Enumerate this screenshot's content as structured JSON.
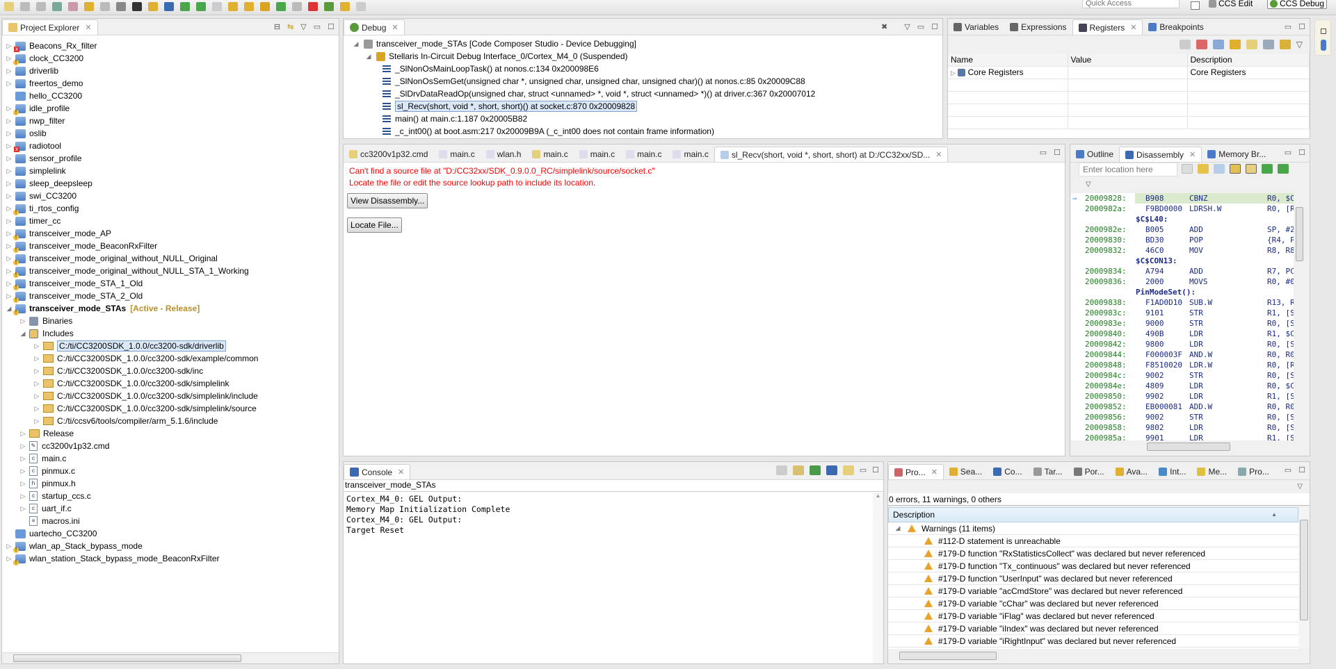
{
  "toolbar": {
    "quick_access_placeholder": "Quick Access",
    "perspectives": [
      "CCS Edit",
      "CCS Debug"
    ]
  },
  "project_explorer": {
    "title": "Project Explorer",
    "items": [
      {
        "label": "Beacons_Rx_filter",
        "level": 0,
        "type": "project",
        "badge": "err",
        "expanded": false
      },
      {
        "label": "clock_CC3200",
        "level": 0,
        "type": "project",
        "badge": "warn",
        "expanded": false
      },
      {
        "label": "driverlib",
        "level": 0,
        "type": "project",
        "badge": "",
        "expanded": false
      },
      {
        "label": "freertos_demo",
        "level": 0,
        "type": "project",
        "badge": "",
        "expanded": false
      },
      {
        "label": "hello_CC3200",
        "level": 0,
        "type": "closed",
        "badge": "",
        "expanded": null
      },
      {
        "label": "idle_profile",
        "level": 0,
        "type": "project",
        "badge": "warn",
        "expanded": false
      },
      {
        "label": "nwp_filter",
        "level": 0,
        "type": "project",
        "badge": "",
        "expanded": false
      },
      {
        "label": "oslib",
        "level": 0,
        "type": "project",
        "badge": "",
        "expanded": false
      },
      {
        "label": "radiotool",
        "level": 0,
        "type": "project",
        "badge": "err",
        "expanded": false
      },
      {
        "label": "sensor_profile",
        "level": 0,
        "type": "project",
        "badge": "",
        "expanded": false
      },
      {
        "label": "simplelink",
        "level": 0,
        "type": "project",
        "badge": "",
        "expanded": false
      },
      {
        "label": "sleep_deepsleep",
        "level": 0,
        "type": "project",
        "badge": "",
        "expanded": false
      },
      {
        "label": "swi_CC3200",
        "level": 0,
        "type": "project",
        "badge": "",
        "expanded": false
      },
      {
        "label": "ti_rtos_config",
        "level": 0,
        "type": "project",
        "badge": "warn",
        "expanded": false
      },
      {
        "label": "timer_cc",
        "level": 0,
        "type": "project",
        "badge": "",
        "expanded": false
      },
      {
        "label": "transceiver_mode_AP",
        "level": 0,
        "type": "project",
        "badge": "warn",
        "expanded": false
      },
      {
        "label": "transceiver_mode_BeaconRxFilter",
        "level": 0,
        "type": "project",
        "badge": "warn",
        "expanded": false
      },
      {
        "label": "transceiver_mode_original_without_NULL_Original",
        "level": 0,
        "type": "project",
        "badge": "warn",
        "expanded": false
      },
      {
        "label": "transceiver_mode_original_without_NULL_STA_1_Working",
        "level": 0,
        "type": "project",
        "badge": "warn",
        "expanded": false
      },
      {
        "label": "transceiver_mode_STA_1_Old",
        "level": 0,
        "type": "project",
        "badge": "warn",
        "expanded": false
      },
      {
        "label": "transceiver_mode_STA_2_Old",
        "level": 0,
        "type": "project",
        "badge": "warn",
        "expanded": false
      },
      {
        "label": "transceiver_mode_STAs",
        "level": 0,
        "type": "project",
        "badge": "warn",
        "expanded": true,
        "bold": true,
        "suffix": "[Active - Release]"
      },
      {
        "label": "Binaries",
        "level": 1,
        "type": "binaries",
        "badge": "",
        "expanded": false
      },
      {
        "label": "Includes",
        "level": 1,
        "type": "includes",
        "badge": "",
        "expanded": true
      },
      {
        "label": "C:/ti/CC3200SDK_1.0.0/cc3200-sdk/driverlib",
        "level": 2,
        "type": "incfolder",
        "badge": "",
        "expanded": false,
        "selected": true
      },
      {
        "label": "C:/ti/CC3200SDK_1.0.0/cc3200-sdk/example/common",
        "level": 2,
        "type": "incfolder",
        "badge": "",
        "expanded": false
      },
      {
        "label": "C:/ti/CC3200SDK_1.0.0/cc3200-sdk/inc",
        "level": 2,
        "type": "incfolder",
        "badge": "",
        "expanded": false
      },
      {
        "label": "C:/ti/CC3200SDK_1.0.0/cc3200-sdk/simplelink",
        "level": 2,
        "type": "incfolder",
        "badge": "",
        "expanded": false
      },
      {
        "label": "C:/ti/CC3200SDK_1.0.0/cc3200-sdk/simplelink/include",
        "level": 2,
        "type": "incfolder",
        "badge": "",
        "expanded": false
      },
      {
        "label": "C:/ti/CC3200SDK_1.0.0/cc3200-sdk/simplelink/source",
        "level": 2,
        "type": "incfolder",
        "badge": "",
        "expanded": false
      },
      {
        "label": "C:/ti/ccsv6/tools/compiler/arm_5.1.6/include",
        "level": 2,
        "type": "incfolder",
        "badge": "",
        "expanded": false
      },
      {
        "label": "Release",
        "level": 1,
        "type": "folder",
        "badge": "",
        "expanded": false
      },
      {
        "label": "cc3200v1p32.cmd",
        "level": 1,
        "type": "file",
        "glyph": "✎",
        "badge": "",
        "expanded": false
      },
      {
        "label": "main.c",
        "level": 1,
        "type": "file",
        "glyph": "c",
        "badge": "warn",
        "expanded": false
      },
      {
        "label": "pinmux.c",
        "level": 1,
        "type": "file",
        "glyph": "c",
        "badge": "",
        "expanded": false
      },
      {
        "label": "pinmux.h",
        "level": 1,
        "type": "file",
        "glyph": "h",
        "badge": "",
        "expanded": false
      },
      {
        "label": "startup_ccs.c",
        "level": 1,
        "type": "file",
        "glyph": "c",
        "badge": "",
        "expanded": false
      },
      {
        "label": "uart_if.c",
        "level": 1,
        "type": "file",
        "glyph": "c",
        "badge": "",
        "expanded": false
      },
      {
        "label": "macros.ini",
        "level": 1,
        "type": "file",
        "glyph": "≡",
        "badge": "",
        "expanded": null
      },
      {
        "label": "uartecho_CC3200",
        "level": 0,
        "type": "closed",
        "badge": "",
        "expanded": null
      },
      {
        "label": "wlan_ap_Stack_bypass_mode",
        "level": 0,
        "type": "project",
        "badge": "warn",
        "expanded": false
      },
      {
        "label": "wlan_station_Stack_bypass_mode_BeaconRxFilter",
        "level": 0,
        "type": "project",
        "badge": "warn",
        "expanded": false
      }
    ]
  },
  "debug": {
    "title": "Debug",
    "session": "transceiver_mode_STAs [Code Composer Studio - Device Debugging]",
    "target": "Stellaris In-Circuit Debug Interface_0/Cortex_M4_0 (Suspended)",
    "frames": [
      "_SlNonOsMainLoopTask() at nonos.c:134 0x200098E6",
      "_SlNonOsSemGet(unsigned char *, unsigned char, unsigned char, unsigned char)() at nonos.c:85 0x20009C88",
      "_SlDrvDataReadOp(unsigned char, struct <unnamed> *, void *, struct <unnamed> *)() at driver.c:367 0x20007012",
      "sl_Recv(short, void *, short, short)() at socket.c:870 0x20009828",
      "main() at main.c:1.187 0x20005B82",
      "_c_int00() at boot.asm:217 0x20009B9A  (_c_int00 does not contain frame information)"
    ],
    "selected_frame": 3
  },
  "variables": {
    "tabs": [
      "Variables",
      "Expressions",
      "Registers",
      "Breakpoints"
    ],
    "active_tab": 2,
    "columns": [
      "Name",
      "Value",
      "Description"
    ],
    "rows": [
      {
        "name": "Core Registers",
        "value": "",
        "description": "Core Registers"
      }
    ]
  },
  "editor": {
    "tabs": [
      "cc3200v1p32.cmd",
      "main.c",
      "wlan.h",
      "main.c",
      "main.c",
      "main.c",
      "main.c",
      "sl_Recv(short, void *, short, short) at D:/CC32xx/SD..."
    ],
    "active_tab": 7,
    "error_line1": "Can't find a source file at \"D:/CC32xx/SDK_0.9.0.0_RC/simplelink/source/socket.c\"",
    "error_line2": "Locate the file or edit the source lookup path to include its location.",
    "view_disassembly": "View Disassembly...",
    "locate_file": "Locate File..."
  },
  "disassembly": {
    "tabs": [
      "Outline",
      "Disassembly",
      "Memory Br..."
    ],
    "active_tab": 1,
    "location_placeholder": "Enter location here",
    "lines": [
      {
        "addr": "20009828:",
        "op": "B908",
        "mn": "CBNZ",
        "arg": "R0, $C",
        "current": true
      },
      {
        "addr": "2000982a:",
        "op": "F9BD0000",
        "mn": "LDRSH.W",
        "arg": "R0, [R"
      },
      {
        "label": "$C$L40:"
      },
      {
        "addr": "2000982e:",
        "op": "B005",
        "mn": "ADD",
        "arg": "SP, #2"
      },
      {
        "addr": "20009830:",
        "op": "BD30",
        "mn": "POP",
        "arg": "{R4, P"
      },
      {
        "addr": "20009832:",
        "op": "46C0",
        "mn": "MOV",
        "arg": "R8, R8"
      },
      {
        "label": "$C$CON13:"
      },
      {
        "addr": "20009834:",
        "op": "A794",
        "mn": "ADD",
        "arg": "R7, PC"
      },
      {
        "addr": "20009836:",
        "op": "2000",
        "mn": "MOVS",
        "arg": "R0, #0"
      },
      {
        "label": "PinModeSet():"
      },
      {
        "addr": "20009838:",
        "op": "F1AD0D10",
        "mn": "SUB.W",
        "arg": "R13, R"
      },
      {
        "addr": "2000983c:",
        "op": "9101",
        "mn": "STR",
        "arg": "R1, [S"
      },
      {
        "addr": "2000983e:",
        "op": "9000",
        "mn": "STR",
        "arg": "R0, [S"
      },
      {
        "addr": "20009840:",
        "op": "490B",
        "mn": "LDR",
        "arg": "R1, $C"
      },
      {
        "addr": "20009842:",
        "op": "9800",
        "mn": "LDR",
        "arg": "R0, [S"
      },
      {
        "addr": "20009844:",
        "op": "F000003F",
        "mn": "AND.W",
        "arg": "R0, R0"
      },
      {
        "addr": "20009848:",
        "op": "F8510020",
        "mn": "LDR.W",
        "arg": "R0, [R"
      },
      {
        "addr": "2000984c:",
        "op": "9002",
        "mn": "STR",
        "arg": "R0, [S"
      },
      {
        "addr": "2000984e:",
        "op": "4809",
        "mn": "LDR",
        "arg": "R0, $C"
      },
      {
        "addr": "20009850:",
        "op": "9902",
        "mn": "LDR",
        "arg": "R1, [S"
      },
      {
        "addr": "20009852:",
        "op": "EB000081",
        "mn": "ADD.W",
        "arg": "R0, R0"
      },
      {
        "addr": "20009856:",
        "op": "9002",
        "mn": "STR",
        "arg": "R0, [S"
      },
      {
        "addr": "20009858:",
        "op": "9802",
        "mn": "LDR",
        "arg": "R0, [S"
      },
      {
        "addr": "2000985a:",
        "op": "9901",
        "mn": "LDR",
        "arg": "R1, [S"
      }
    ]
  },
  "console": {
    "title": "Console",
    "process": "transceiver_mode_STAs",
    "lines": [
      "Cortex_M4_0: GEL Output:",
      "Memory Map Initialization Complete",
      "Cortex_M4_0: GEL Output:",
      "Target Reset"
    ]
  },
  "problems": {
    "tabs": [
      "Pro...",
      "Sea...",
      "Co...",
      "Tar...",
      "Por...",
      "Ava...",
      "Int...",
      "Me...",
      "Pro..."
    ],
    "active_tab": 0,
    "summary": "0 errors, 11 warnings, 0 others",
    "column": "Description",
    "group": "Warnings (11 items)",
    "items": [
      "#112-D statement is unreachable",
      "#179-D function \"RxStatisticsCollect\" was declared but never referenced",
      "#179-D function \"Tx_continuous\" was declared but never referenced",
      "#179-D function \"UserInput\" was declared but never referenced",
      "#179-D variable \"acCmdStore\" was declared but never referenced",
      "#179-D variable \"cChar\" was declared but never referenced",
      "#179-D variable \"iFlag\" was declared but never referenced",
      "#179-D variable \"iIndex\" was declared but never referenced",
      "#179-D variable \"iRightInput\" was declared but never referenced"
    ]
  },
  "colors": {
    "error_text": "#ff0000",
    "active_suffix": "#b8912a",
    "disasm_addr": "#1e7d1e",
    "disasm_code": "#1a2a8a",
    "current_line": "#dbe9cc"
  }
}
